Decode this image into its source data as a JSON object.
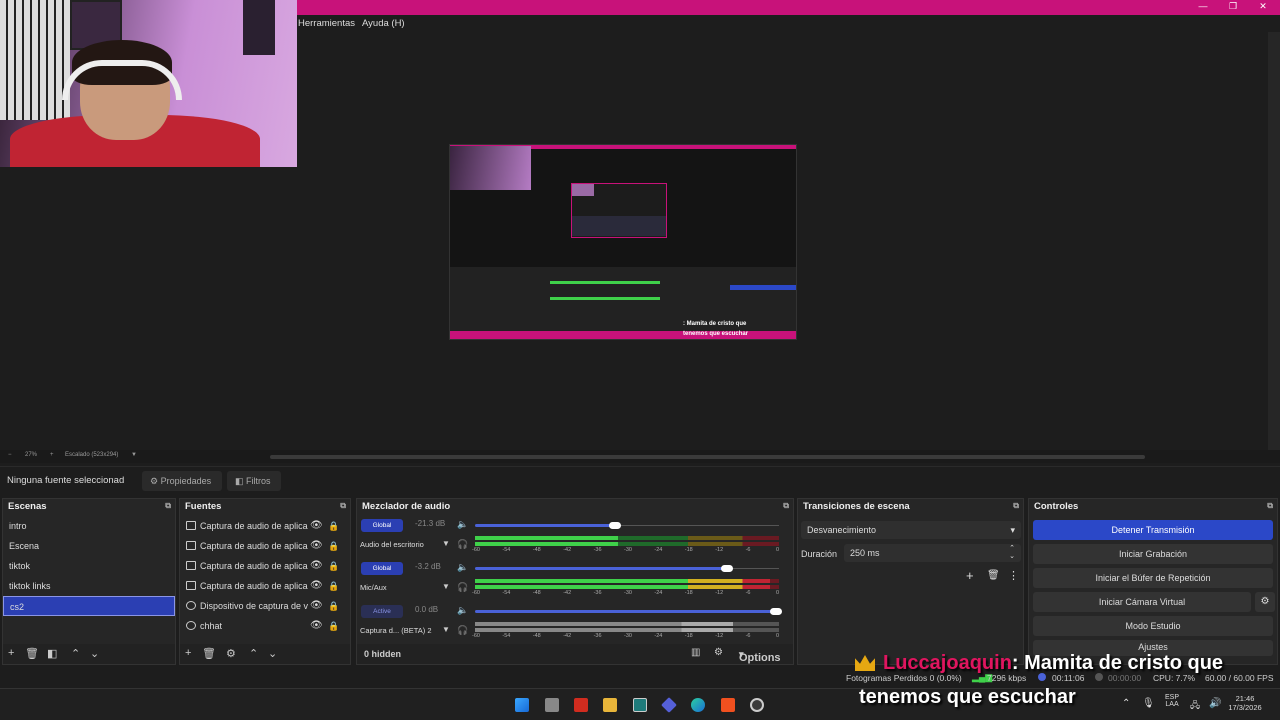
{
  "menu": {
    "tools": "Herramientas",
    "help": "Ayuda (H)"
  },
  "preview_status": {
    "zoom": "27%",
    "scale_label": "Escalado (523x294)",
    "minus": "−",
    "plus": "+"
  },
  "source_bar": {
    "no_source": "Ninguna fuente seleccionad",
    "properties": "Propiedades",
    "filters": "Filtros"
  },
  "scenes": {
    "title": "Escenas",
    "items": [
      "intro",
      "Escena",
      "tiktok",
      "tiktok links",
      "cs2"
    ],
    "selected_index": 4
  },
  "sources": {
    "title": "Fuentes",
    "items": [
      {
        "label": "Captura de audio de aplica",
        "icon": "app-audio-icon"
      },
      {
        "label": "Captura de audio de aplica",
        "icon": "app-audio-icon"
      },
      {
        "label": "Captura de audio de aplica",
        "icon": "app-audio-icon"
      },
      {
        "label": "Captura de audio de aplica",
        "icon": "app-audio-icon"
      },
      {
        "label": "Dispositivo de captura de v",
        "icon": "camera-icon"
      },
      {
        "label": "chhat",
        "icon": "browser-icon"
      }
    ]
  },
  "mixer": {
    "title": "Mezclador de audio",
    "channels": [
      {
        "badge": "Global",
        "db": "-21.3 dB",
        "name": "Audio del escritorio",
        "level": 0.47,
        "fader": 0.46
      },
      {
        "badge": "Global",
        "db": "-3.2 dB",
        "name": "Mic/Aux",
        "level": 0.97,
        "fader": 0.83
      },
      {
        "badge": "Active",
        "db": "0.0 dB",
        "name": "Captura d... (BETA) 2",
        "level": 0.85,
        "fader": 0.99
      }
    ],
    "scale": [
      "-60",
      "-54",
      "-48",
      "-42",
      "-36",
      "-30",
      "-24",
      "-18",
      "-12",
      "-6",
      "0"
    ],
    "hidden": "0 hidden",
    "options": "Options"
  },
  "transitions": {
    "title": "Transiciones de escena",
    "type": "Desvanecimiento",
    "duration_label": "Duración",
    "duration_value": "250 ms"
  },
  "controls": {
    "title": "Controles",
    "buttons": [
      "Detener Transmisión",
      "Iniciar Grabación",
      "Iniciar el Búfer de Repetición",
      "Iniciar Cámara Virtual",
      "Modo Estudio",
      "Ajustes"
    ]
  },
  "status": {
    "dropped": "Fotogramas Perdidos 0 (0.0%)",
    "bitrate": "7296 kbps",
    "live_time": "00:11:06",
    "rec_time": "00:00:00",
    "cpu": "CPU: 7.7%",
    "fps": "60.00 / 60.00 FPS"
  },
  "chat": {
    "user": "Luccajoaquin",
    "message_line1": ": Mamita de cristo que",
    "message_line2": "tenemos que escuchar"
  },
  "taskbar": {
    "lang1": "ESP",
    "lang2": "LAA",
    "time": "21:46",
    "date": "17/3/2026"
  },
  "colors": {
    "accent": "#c8127a",
    "selection": "#2b3fb3",
    "meter_green": "#3fd14a",
    "meter_yellow": "#d2b021",
    "meter_red": "#c02433"
  }
}
